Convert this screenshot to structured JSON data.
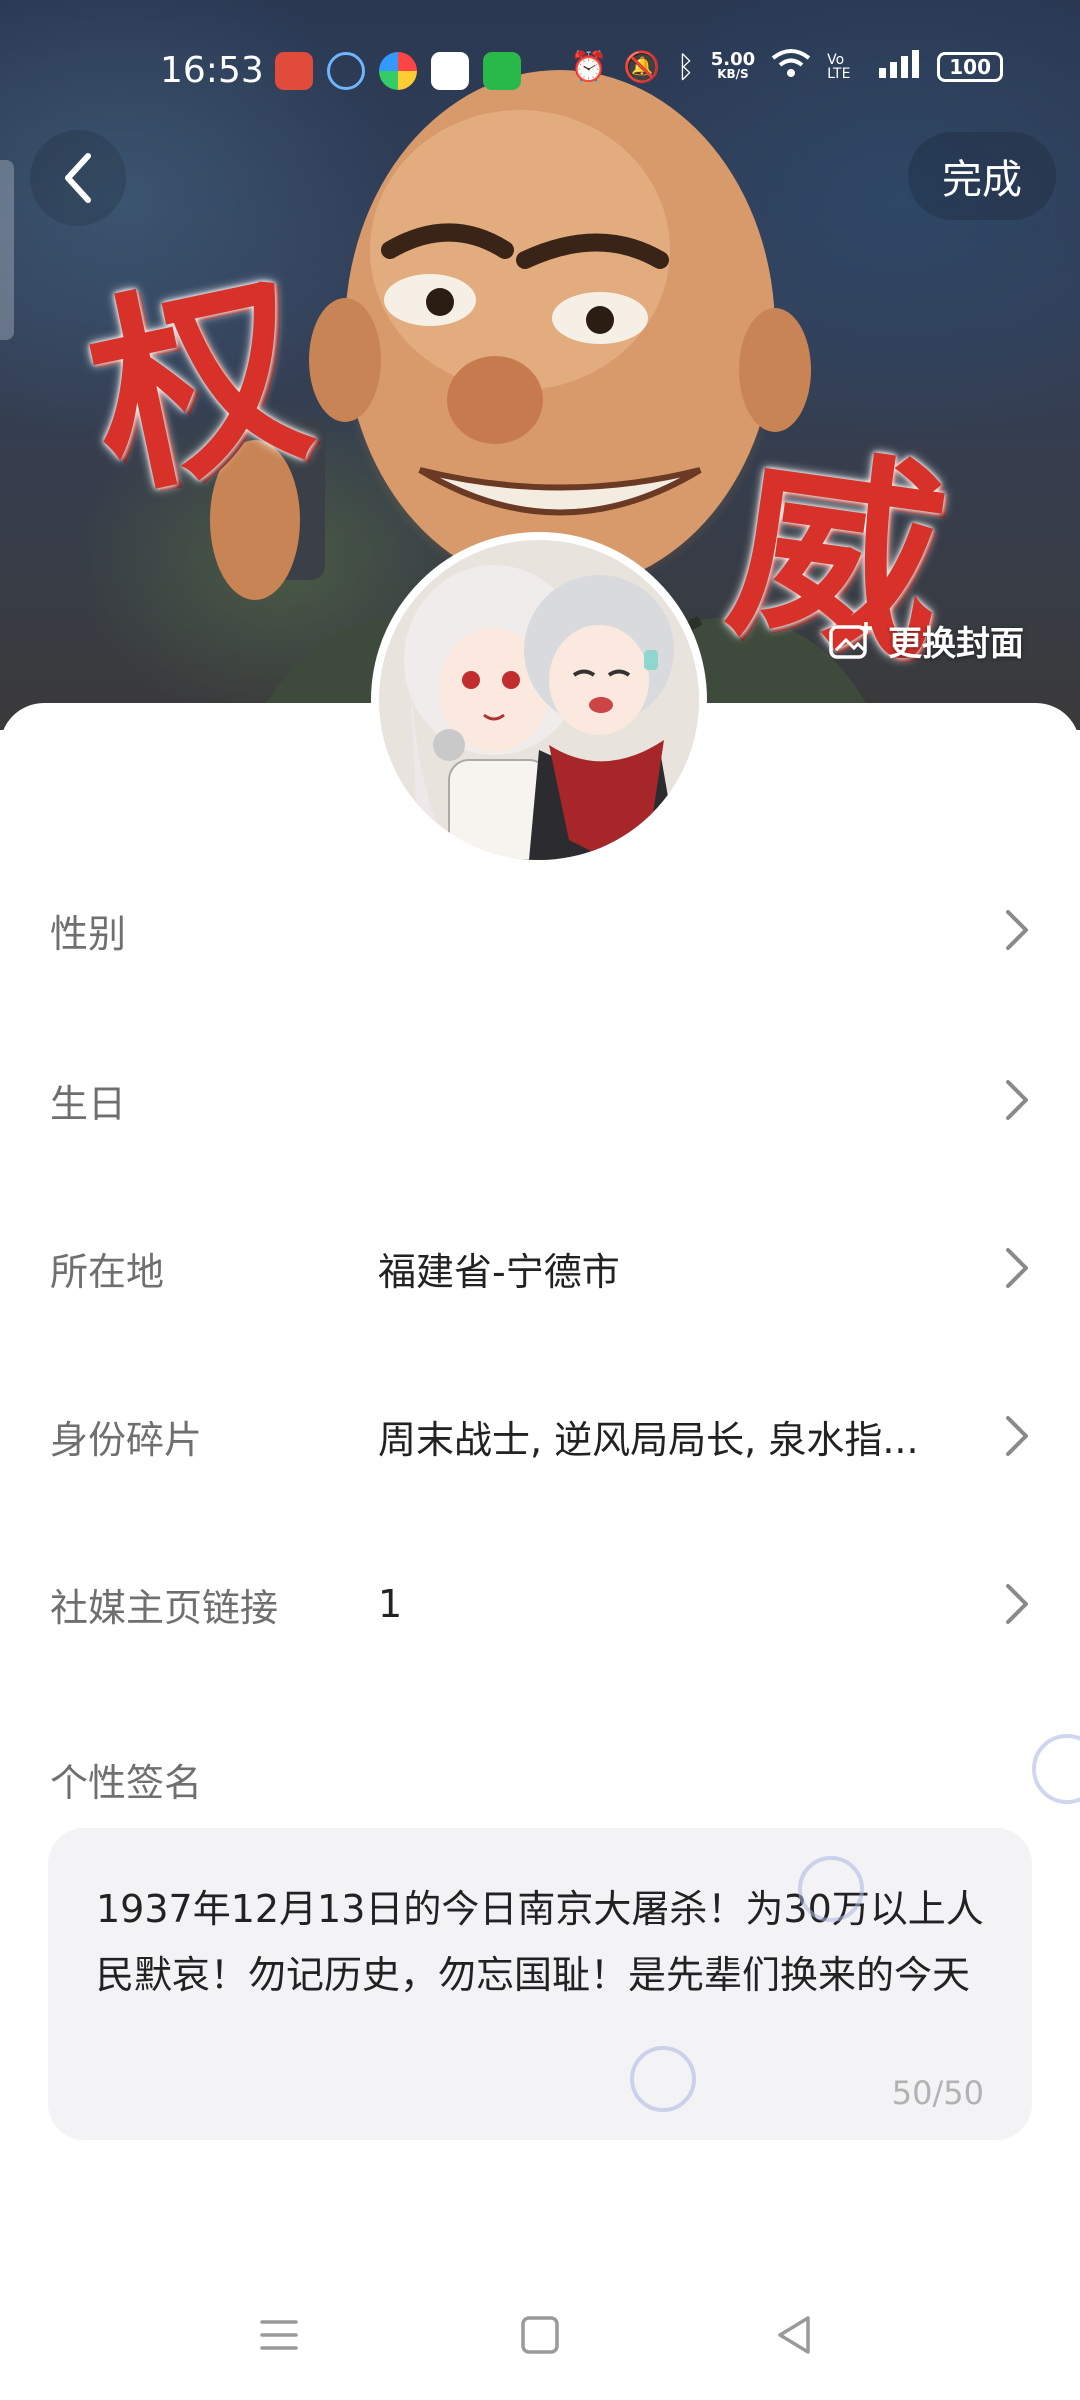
{
  "status_bar": {
    "time": "16:53",
    "net_speed_value": "5.00",
    "net_speed_unit": "KB/S",
    "network_type": "Vo LTE",
    "battery": "100"
  },
  "header": {
    "back_icon": "chevron-left-icon",
    "done_label": "完成",
    "change_cover_label": "更换封面"
  },
  "cover": {
    "calligraphy_1": "权",
    "calligraphy_2": "威"
  },
  "profile_rows": [
    {
      "label": "性别",
      "value": ""
    },
    {
      "label": "生日",
      "value": ""
    },
    {
      "label": "所在地",
      "value": "福建省-宁德市"
    },
    {
      "label": "身份碎片",
      "value": "周末战士, 逆风局局长, 泉水指..."
    },
    {
      "label": "社媒主页链接",
      "value": "1"
    }
  ],
  "signature": {
    "label": "个性签名",
    "text": "1937年12月13日的今日南京大屠杀！为30万以上人民默哀！勿记历史，勿忘国耻！是先辈们换来的今天",
    "count": "50/50"
  },
  "nav": {
    "menu_icon": "menu-icon",
    "home_icon": "home-square-icon",
    "back_icon": "back-triangle-icon"
  },
  "colors": {
    "label": "#6f6f6f",
    "value": "#222222",
    "sig_box": "#f3f3f5",
    "calligraphy": "#d8312a"
  }
}
